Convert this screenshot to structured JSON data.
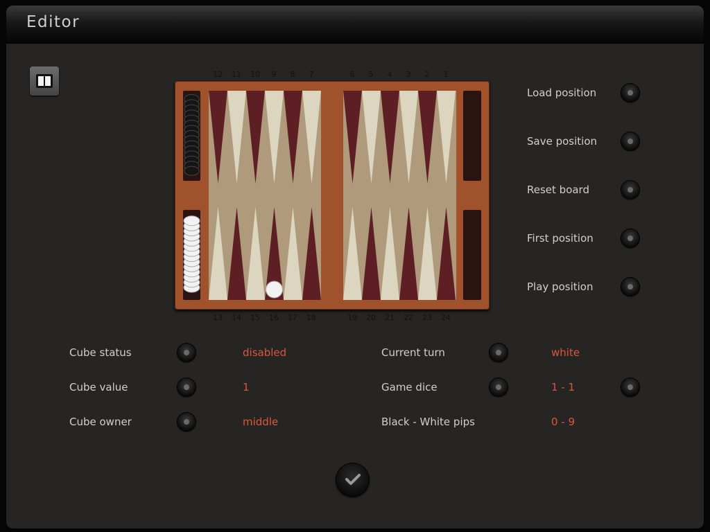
{
  "window": {
    "title": "Editor"
  },
  "board": {
    "top_numbers": [
      "12",
      "11",
      "10",
      "9",
      "8",
      "7",
      "6",
      "5",
      "4",
      "3",
      "2",
      "1"
    ],
    "bottom_numbers": [
      "13",
      "14",
      "15",
      "16",
      "17",
      "18",
      "19",
      "20",
      "21",
      "22",
      "23",
      "24"
    ],
    "checkers": [
      {
        "point": 16,
        "color": "white",
        "count": 1
      }
    ],
    "tray_black_count": 15,
    "tray_white_count": 14,
    "colors": {
      "frame": "#a0522d",
      "felt": "#b09a7c",
      "dark_point": "#5e1f24",
      "light_point": "#dcd6c0"
    }
  },
  "side_buttons": [
    {
      "label": "Load position"
    },
    {
      "label": "Save position"
    },
    {
      "label": "Reset board"
    },
    {
      "label": "First position"
    },
    {
      "label": "Play position"
    }
  ],
  "settings": {
    "cube_status": {
      "label": "Cube status",
      "value": "disabled"
    },
    "cube_value": {
      "label": "Cube value",
      "value": "1"
    },
    "cube_owner": {
      "label": "Cube owner",
      "value": "middle"
    },
    "current_turn": {
      "label": "Current turn",
      "value": "white"
    },
    "game_dice": {
      "label": "Game dice",
      "value": "1 - 1"
    },
    "pips": {
      "label": "Black - White pips",
      "value": "0 - 9"
    }
  },
  "colors": {
    "accent": "#d9573a",
    "text": "#cfcfcf",
    "panel": "#262524"
  }
}
